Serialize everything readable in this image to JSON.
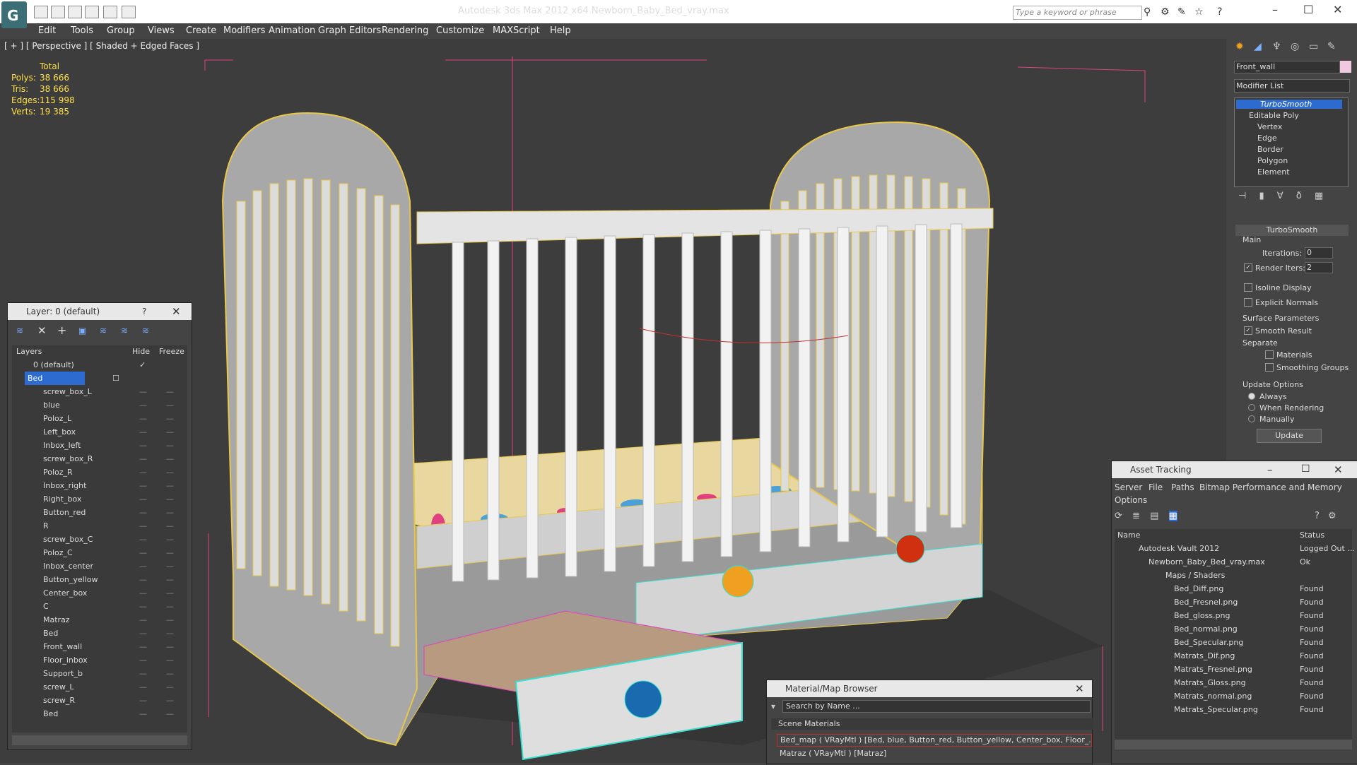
{
  "window": {
    "title": "Autodesk 3ds Max  2012 x64      Newborn_Baby_Bed_vray.max",
    "search_placeholder": "Type a keyword or phrase"
  },
  "menu": [
    "Edit",
    "Tools",
    "Group",
    "Views",
    "Create",
    "Modifiers",
    "Animation",
    "Graph Editors",
    "Rendering",
    "Customize",
    "MAXScript",
    "Help"
  ],
  "viewport": {
    "label": "[ + ] [ Perspective ] [ Shaded + Edged Faces ]",
    "stats_header": "Total",
    "stats": [
      {
        "k": "Polys:",
        "v": "38 666"
      },
      {
        "k": "Tris:",
        "v": "38 666"
      },
      {
        "k": "Edges:",
        "v": "115 998"
      },
      {
        "k": "Verts:",
        "v": "19 385"
      }
    ]
  },
  "layers": {
    "title": "Layer: 0 (default)",
    "help": "?",
    "col_layers": "Layers",
    "col_hide": "Hide",
    "col_freeze": "Freeze",
    "items": [
      "0 (default)",
      "Bed",
      "screw_box_L",
      "blue",
      "Poloz_L",
      "Left_box",
      "Inbox_left",
      "screw_box_R",
      "Poloz_R",
      "Inbox_right",
      "Right_box",
      "Button_red",
      "R",
      "screw_box_C",
      "Poloz_C",
      "Inbox_center",
      "Button_yellow",
      "Center_box",
      "C",
      "Matraz",
      "Bed",
      "Front_wall",
      "Floor_inbox",
      "Support_b",
      "screw_L",
      "screw_R",
      "Bed"
    ]
  },
  "command_panel": {
    "object_name": "Front_wall",
    "modifier_list": "Modifier List",
    "stack": [
      "TurboSmooth",
      "Editable Poly",
      "Vertex",
      "Edge",
      "Border",
      "Polygon",
      "Element"
    ],
    "rollout_title": "TurboSmooth",
    "main": "Main",
    "iterations_label": "Iterations:",
    "iterations_value": "0",
    "render_iters_label": "Render Iters:",
    "render_iters_value": "2",
    "isoline": "Isoline Display",
    "explicit_normals": "Explicit Normals",
    "surface_params": "Surface Parameters",
    "smooth_result": "Smooth Result",
    "separate": "Separate",
    "materials": "Materials",
    "smoothing_groups": "Smoothing Groups",
    "update_options": "Update Options",
    "always": "Always",
    "when_rendering": "When Rendering",
    "manually": "Manually",
    "update_button": "Update"
  },
  "asset_tracking": {
    "title": "Asset Tracking",
    "menu": [
      "Server",
      "File",
      "Paths",
      "Bitmap Performance and Memory"
    ],
    "menu2": "Options",
    "col_name": "Name",
    "col_status": "Status",
    "rows": [
      {
        "name": "Autodesk Vault 2012",
        "status": "Logged Out ..."
      },
      {
        "name": "Newborn_Baby_Bed_vray.max",
        "status": "Ok"
      },
      {
        "name": "Maps / Shaders",
        "status": ""
      },
      {
        "name": "Bed_Diff.png",
        "status": "Found"
      },
      {
        "name": "Bed_Fresnel.png",
        "status": "Found"
      },
      {
        "name": "Bed_gloss.png",
        "status": "Found"
      },
      {
        "name": "Bed_normal.png",
        "status": "Found"
      },
      {
        "name": "Bed_Specular.png",
        "status": "Found"
      },
      {
        "name": "Matrats_Dif.png",
        "status": "Found"
      },
      {
        "name": "Matrats_Fresnel.png",
        "status": "Found"
      },
      {
        "name": "Matrats_Gloss.png",
        "status": "Found"
      },
      {
        "name": "Matrats_normal.png",
        "status": "Found"
      },
      {
        "name": "Matrats_Specular.png",
        "status": "Found"
      }
    ]
  },
  "material_browser": {
    "title": "Material/Map Browser",
    "search": "Search by Name ...",
    "section": "Scene Materials",
    "items": [
      "Bed_map  ( VRayMtl ) [Bed, blue, Button_red, Button_yellow, Center_box, Floor_...",
      "Matraz  ( VRayMtl ) [Matraz]"
    ]
  },
  "colors": {
    "accent": "#2d6bd0",
    "stats": "#ffe04a",
    "wire_yellow": "#e8c84a",
    "wire_cyan": "#38e0d0"
  }
}
